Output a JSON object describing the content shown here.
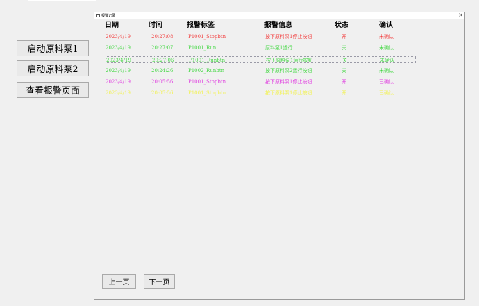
{
  "left_buttons": {
    "start_pump1": "启动原料泵1",
    "start_pump2": "启动原料泵2",
    "view_alarms": "查看报警页面"
  },
  "window": {
    "title": "报警记录",
    "close": "×"
  },
  "table": {
    "headers": {
      "date": "日期",
      "time": "时间",
      "tag": "报警标签",
      "info": "报警信息",
      "status": "状态",
      "confirm": "确认"
    },
    "rows": [
      {
        "date": "2023/4/19",
        "time": "20:27:08",
        "tag": "P1001_Stopbtn",
        "info": "按下原料泵1停止按钮",
        "status": "开",
        "confirm": "未确认",
        "color": "#f24848"
      },
      {
        "date": "2023/4/19",
        "time": "20:27:07",
        "tag": "P1001_Run",
        "info": "原料泵1运行",
        "status": "关",
        "confirm": "未确认",
        "color": "#48d848"
      },
      {
        "date": "2023/4/19",
        "time": "20:27:06",
        "tag": "P1001_Runbtn",
        "info": "按下原料泵1运行按钮",
        "status": "关",
        "confirm": "未确认",
        "color": "#48d848"
      },
      {
        "date": "2023/4/19",
        "time": "20:24:26",
        "tag": "P1002_Runbtn",
        "info": "按下原料泵2运行按钮",
        "status": "关",
        "confirm": "未确认",
        "color": "#48d848"
      },
      {
        "date": "2023/4/19",
        "time": "20:05:56",
        "tag": "P1001_Stopbtn",
        "info": "按下原料泵1停止按钮",
        "status": "开",
        "confirm": "已确认",
        "color": "#e040e0"
      },
      {
        "date": "2023/4/19",
        "time": "20:05:56",
        "tag": "P1001_Stopbtn",
        "info": "按下原料泵1停止按钮",
        "status": "开",
        "confirm": "已确认",
        "color": "#f2f252"
      }
    ]
  },
  "pager": {
    "prev": "上一页",
    "next": "下一页"
  }
}
